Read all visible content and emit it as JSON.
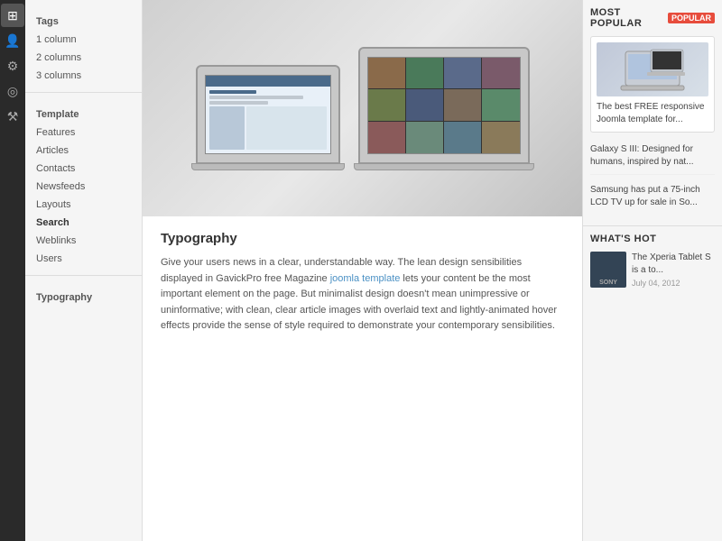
{
  "leftIcons": [
    {
      "name": "home-icon",
      "symbol": "⊞"
    },
    {
      "name": "user-icon",
      "symbol": "👤"
    },
    {
      "name": "settings-icon",
      "symbol": "⚙"
    },
    {
      "name": "globe-icon",
      "symbol": "◎"
    },
    {
      "name": "tools-icon",
      "symbol": "⚒"
    }
  ],
  "navSections": [
    {
      "header": "Tags",
      "items": [
        "1 column",
        "2 columns",
        "3 columns"
      ]
    },
    {
      "header": "Template",
      "items": [
        "Features",
        "Articles",
        "Contacts",
        "Newsfeeds",
        "Layouts",
        "Search",
        "Weblinks",
        "Users"
      ]
    },
    {
      "header": "Typography",
      "items": []
    }
  ],
  "mainContent": {
    "bodyText": "Give your users news in a clear, understandable way. The lean design sensibilities displayed in GavickPro free Magazine ",
    "linkText": "joomla template",
    "bodyText2": " lets your content be the most important element on the page. But minimalist design doesn't mean unimpressive or uninformative; with clean, clear article images with overlaid text and lightly-animated hover effects provide the sense of style required to demonstrate your contemporary sensibilities."
  },
  "rightSidebar": {
    "mostPopular": {
      "title": "MOST POPULAR",
      "badge": "POPULAR",
      "items": [
        {
          "title": "The best FREE responsive Joomla template for..."
        }
      ],
      "listItems": [
        "Galaxy S III: Designed for humans, inspired by nat...",
        "Samsung has put a 75-inch LCD TV up for sale in So..."
      ]
    },
    "whatsHot": {
      "title": "WHAT'S HOT",
      "items": [
        {
          "brand": "SONY",
          "title": "The Xperia Tablet S is a to...",
          "date": "July 04, 2012"
        }
      ]
    }
  }
}
